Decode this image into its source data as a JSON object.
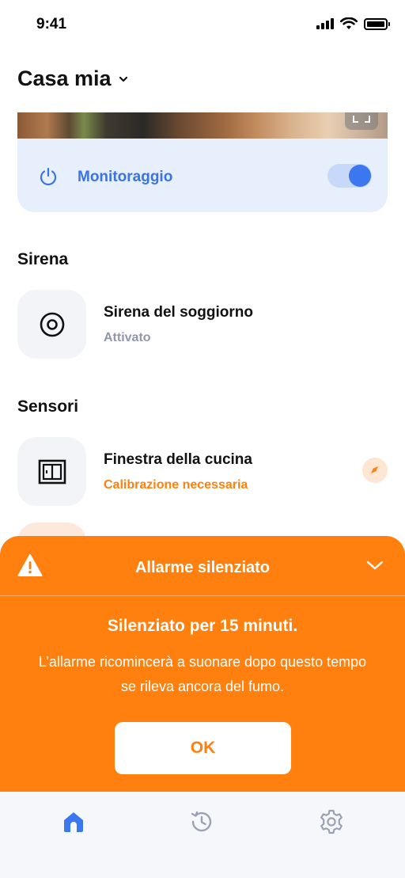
{
  "status_bar": {
    "time": "9:41"
  },
  "header": {
    "home_name": "Casa mia"
  },
  "monitoring": {
    "label": "Monitoraggio",
    "enabled": true,
    "accent": "#3a73e6"
  },
  "siren_section": {
    "title": "Sirena",
    "device": {
      "name": "Sirena del soggiorno",
      "status": "Attivato",
      "icon": "siren-icon"
    }
  },
  "sensors_section": {
    "title": "Sensori",
    "device": {
      "name": "Finestra della cucina",
      "status": "Calibrazione necessaria",
      "icon": "window-icon",
      "status_color": "#ff7f0f"
    }
  },
  "alert": {
    "title": "Allarme silenziato",
    "headline": "Silenziato per 15 minuti.",
    "body": "L’allarme ricomincerà a suonare dopo questo tempo se rileva ancora del fumo.",
    "ok_label": "OK",
    "color": "#ff7f0f"
  },
  "tabbar": {
    "items": [
      {
        "icon": "home-icon",
        "active": true
      },
      {
        "icon": "history-icon",
        "active": false
      },
      {
        "icon": "settings-icon",
        "active": false
      }
    ]
  }
}
